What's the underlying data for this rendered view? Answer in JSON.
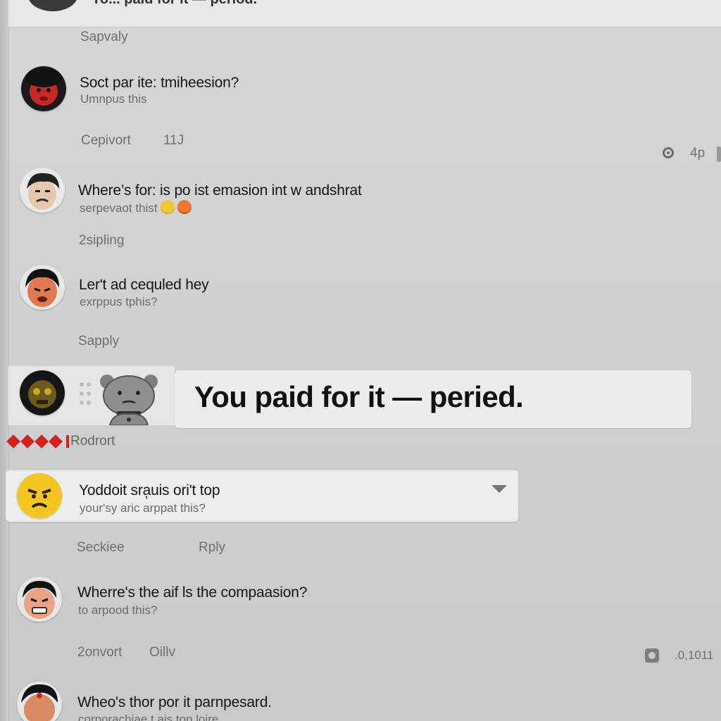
{
  "top": {
    "title": "Yo... paid for it — period."
  },
  "threads": [
    {
      "label": "Sapvaly",
      "title": "Soct par ite: tmiheesion?",
      "subtitle": "Umnpus this",
      "actions": [
        "Cepivort",
        "11J"
      ],
      "side": "4p"
    },
    {
      "title": "Where’s for: is po ist emasion int w andshrat",
      "subtitle": "serpevaot thist",
      "meta": "2sipling"
    },
    {
      "title": "Ler't ad cequled hey",
      "subtitle": "exrppus tphis?",
      "meta": "Sapply"
    }
  ],
  "highlight": {
    "text": "You paid for it — peried."
  },
  "red_label": "Rodrort",
  "card": {
    "title": "Yoddoit sra̦uis ori't top",
    "subtitle": "your'sy aric arppat this?",
    "actions": [
      "Seckiee",
      "Rply"
    ]
  },
  "thread4": {
    "title": "Wherre's the aif ls the compaasion?",
    "subtitle": "to arpood this?",
    "actions": [
      "2onvort",
      "Oillv"
    ],
    "side": ".0,1011"
  },
  "thread5": {
    "title": "Wheo's thor por it parnpesard.",
    "subtitle": "corporachiae t ais ton loire"
  },
  "colors": {
    "accent_red": "#d61f1f",
    "emoji_yellow": "#f2c832",
    "emoji_orange": "#f0772d"
  }
}
